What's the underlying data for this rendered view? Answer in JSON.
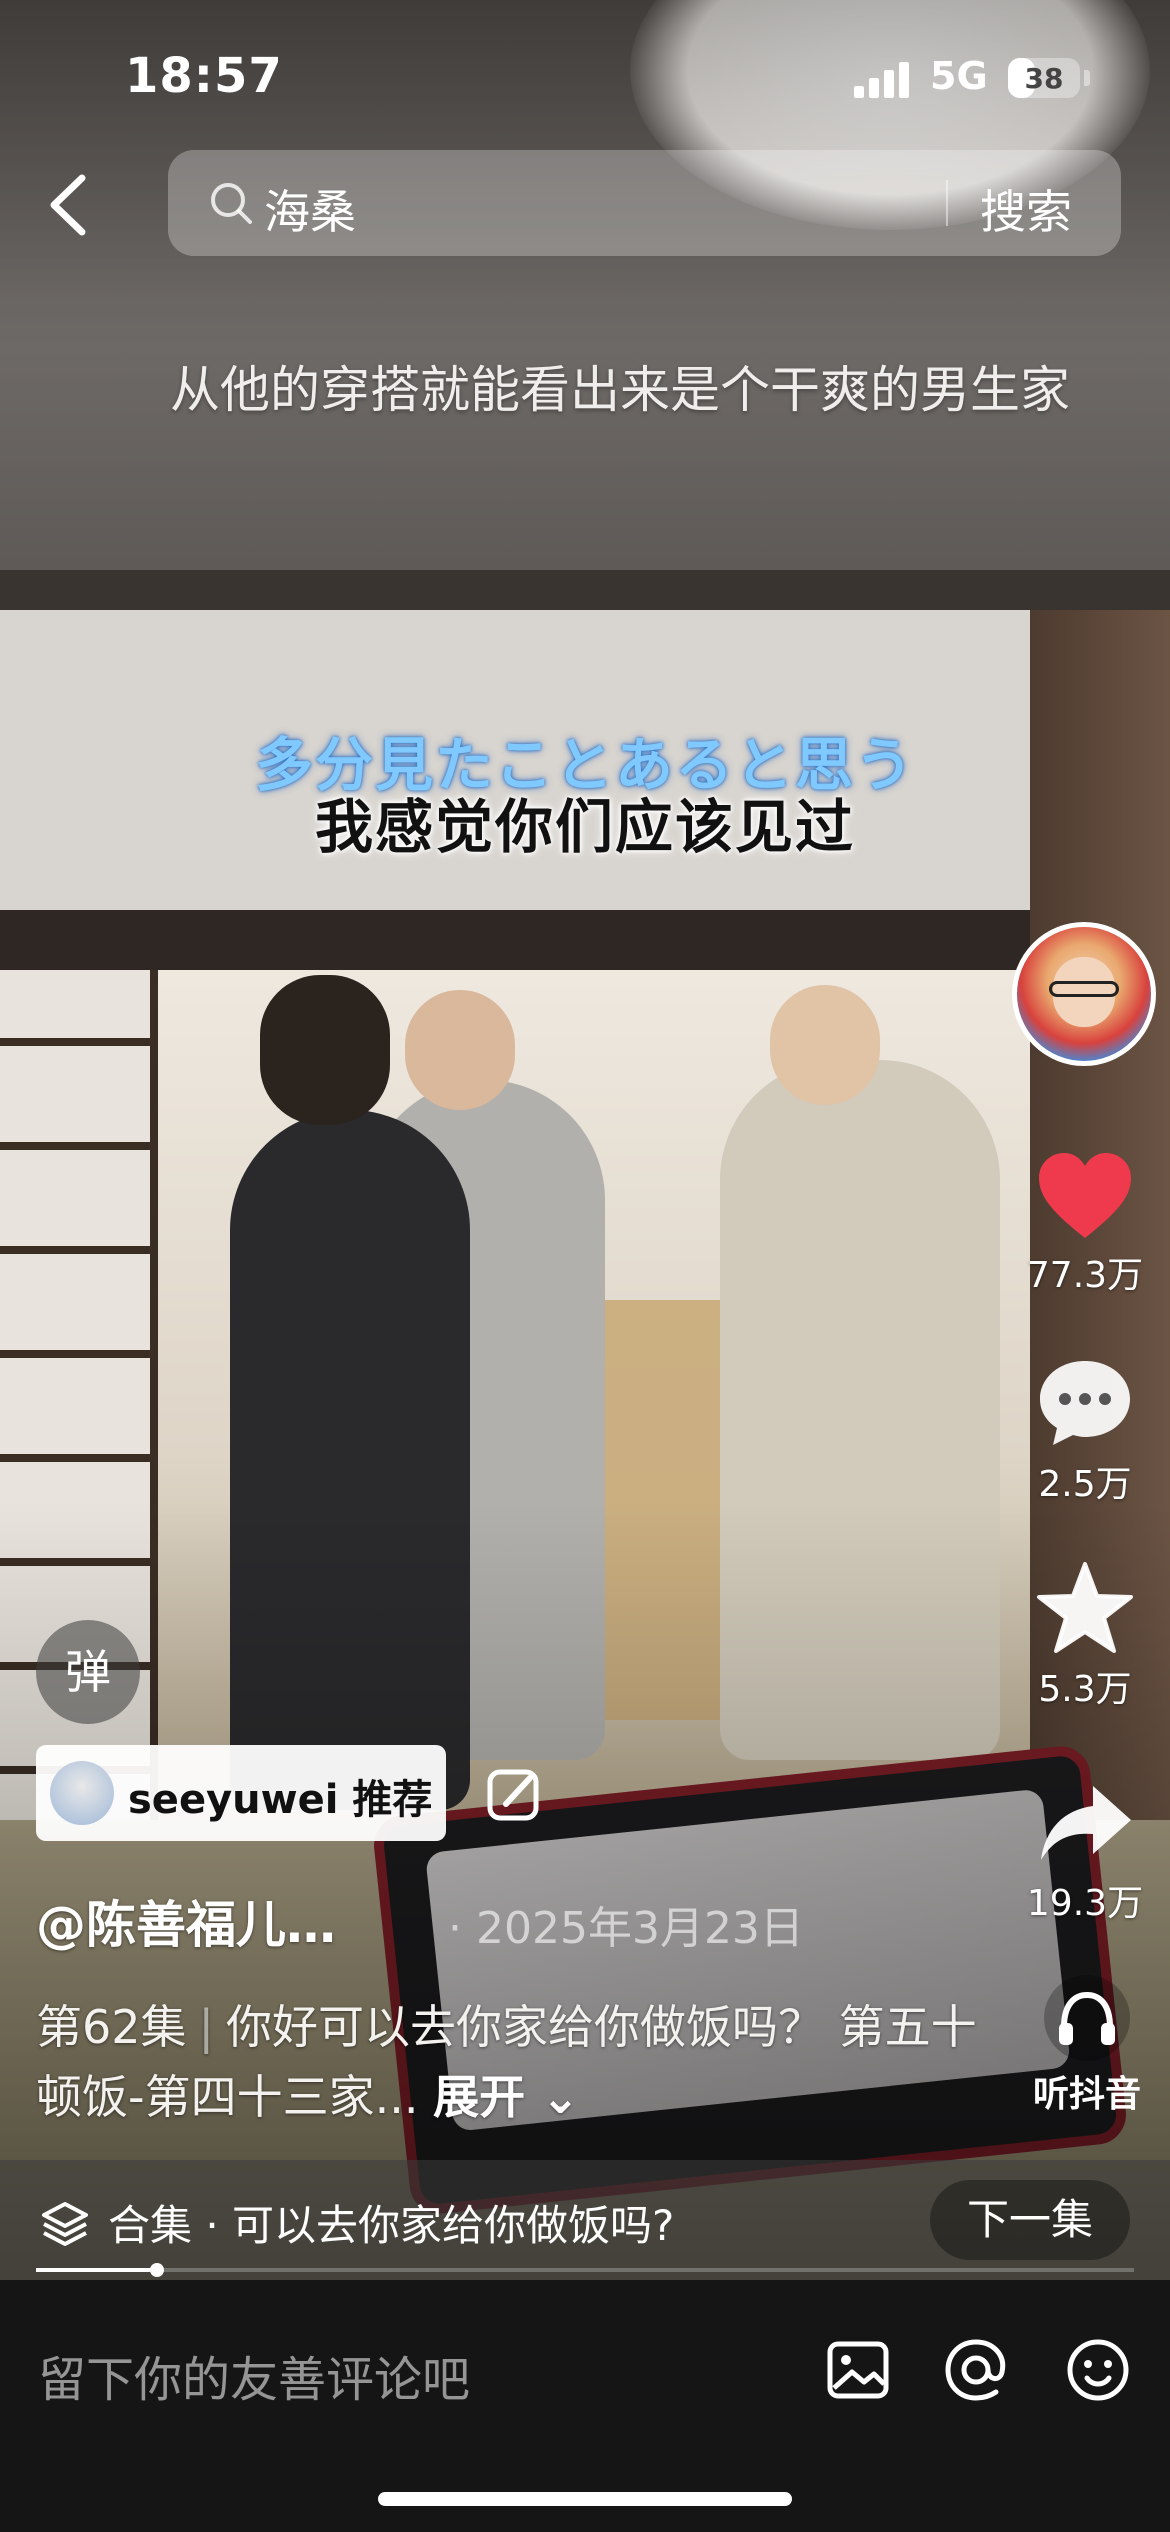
{
  "status_bar": {
    "time": "18:57",
    "network": "5G",
    "battery": "38",
    "battery_level": 0.38
  },
  "search": {
    "query": "海桑",
    "button_label": "搜索"
  },
  "video": {
    "top_caption": "从他的穿搭就能看出来是个干爽的男生家",
    "subtitle_jp": "多分見たことあると思う",
    "subtitle_cn": "我感觉你们应该见过",
    "progress": 0.11
  },
  "sidebar": {
    "likes": "77.3万",
    "comments": "2.5万",
    "favorites": "5.3万",
    "shares": "19.3万",
    "listen_label": "听抖音"
  },
  "danmu_label": "弹",
  "recommender": {
    "name": "seeyuwei",
    "tag": "推荐"
  },
  "author": "@陈善福儿…",
  "date": "· 2025年3月23日",
  "description": {
    "episode": "第62集",
    "text": "你好可以去你家给你做饭吗？ 第五十顿饭-第四十三家...",
    "expand_label": "展开"
  },
  "collection": {
    "label": "合集 · 可以去你家给你做饭吗?",
    "next_label": "下一集"
  },
  "comment_bar": {
    "placeholder": "留下你的友善评论吧"
  },
  "colors": {
    "like": "#ee3a4c",
    "subtitle_jp": "#7fc9ff",
    "comment_bar_bg": "#151515"
  },
  "icons": [
    "back-arrow-icon",
    "search-icon",
    "heart-icon",
    "comment-bubble-icon",
    "star-icon",
    "share-arrow-icon",
    "headphones-icon",
    "layers-icon",
    "edit-icon",
    "image-icon",
    "at-icon",
    "emoji-icon"
  ]
}
